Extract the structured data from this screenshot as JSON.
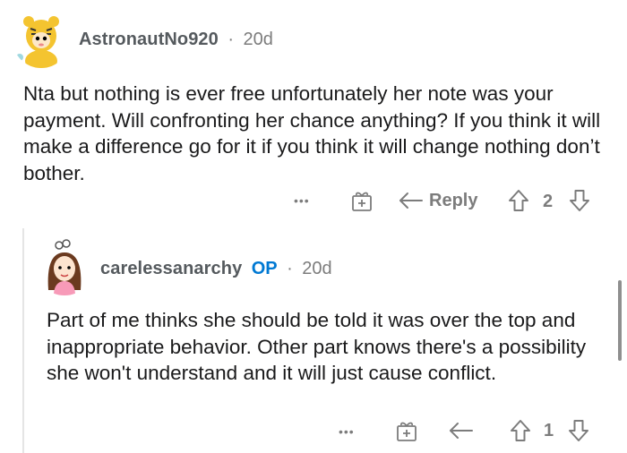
{
  "comments": [
    {
      "username": "AstronautNo920",
      "separator": "·",
      "age": "20d",
      "text": "Nta but nothing is ever free unfortunately her note was your payment. Will confronting her chance anything? If you think it will make a difference go for it if you think it will change nothing don’t bother.",
      "actions": {
        "more": "•••",
        "reply": "Reply",
        "score": "2"
      }
    },
    {
      "username": "carelessanarchy",
      "op_badge": "OP",
      "separator": "·",
      "age": "20d",
      "text": "Part of me thinks she should be told it was over the top and inappropriate behavior. Other part knows there's a possibility she won't understand and it will just cause conflict.",
      "actions": {
        "more": "•••",
        "score": "1"
      }
    }
  ],
  "icons": [
    "avatar-tiger-icon",
    "avatar-girl-icon",
    "more-icon",
    "award-icon",
    "reply-icon",
    "upvote-icon",
    "downvote-icon"
  ],
  "colors": {
    "op_badge": "#0079d3",
    "muted": "#7c7c7c",
    "text": "#1a1a1b",
    "thread_line": "#e5e5e5"
  }
}
